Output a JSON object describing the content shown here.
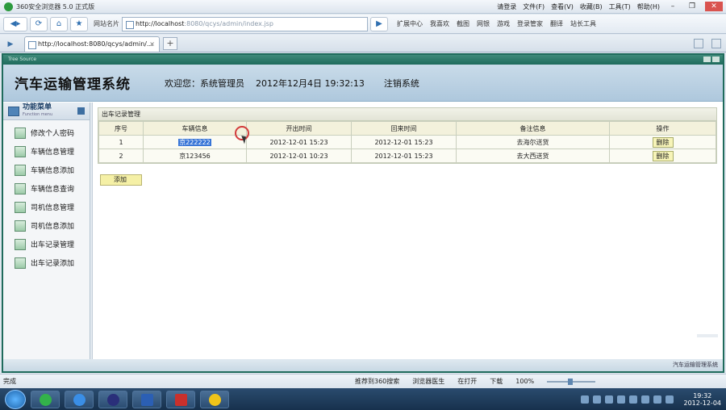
{
  "browser": {
    "title": "360安全浏览器 5.0 正式版",
    "top_right": [
      "请登录",
      "文件(F)",
      "查看(V)",
      "收藏(B)",
      "工具(T)",
      "帮助(H)"
    ],
    "address_label": "网站名片",
    "url_host": "http://localhost",
    "url_rest": ":8080/qcys/admin/index.jsp",
    "nav_tools": [
      "扩展中心",
      "我喜欢",
      "截图",
      "网银",
      "游戏",
      "登录管家",
      "翻译",
      "站长工具"
    ],
    "tab_title": "http://localhost:8080/qcys/admin/...",
    "status_done": "完成",
    "status_items": [
      "推荐到360搜索",
      "浏览器医生",
      "在打开",
      "下载"
    ],
    "zoom": "100%"
  },
  "app": {
    "frame_caption": "Tree Source",
    "title": "汽车运输管理系统",
    "welcome": "欢迎您：系统管理员",
    "date": "2012年12月4日  19:32:13",
    "logout": "注销系统",
    "footer": "汽车运输管理系统"
  },
  "sidebar": {
    "title": "功能菜单",
    "subtitle": "Function menu",
    "items": [
      {
        "label": "修改个人密码"
      },
      {
        "label": "车辆信息管理"
      },
      {
        "label": "车辆信息添加"
      },
      {
        "label": "车辆信息查询"
      },
      {
        "label": "司机信息管理"
      },
      {
        "label": "司机信息添加"
      },
      {
        "label": "出车记录管理"
      },
      {
        "label": "出车记录添加"
      }
    ]
  },
  "main": {
    "panel_title": "出车记录管理",
    "columns": [
      "序号",
      "车辆信息",
      "开出时间",
      "回来时间",
      "备注信息",
      "操作"
    ],
    "rows": [
      {
        "no": "1",
        "vehicle": "京222222",
        "depart": "2012-12-01 15:23",
        "return": "2012-12-01 15:23",
        "note": "去海尔送货",
        "action": "删除"
      },
      {
        "no": "2",
        "vehicle": "京123456",
        "depart": "2012-12-01 10:23",
        "return": "2012-12-01 15:23",
        "note": "去大西送货",
        "action": "删除"
      }
    ],
    "add_label": "添加"
  },
  "taskbar": {
    "time": "19:32",
    "date": "2012-12-04"
  },
  "colors": {
    "frame_border": "#1f6b5c",
    "header_bg": "#aec8dd",
    "selection": "#3875d7"
  }
}
